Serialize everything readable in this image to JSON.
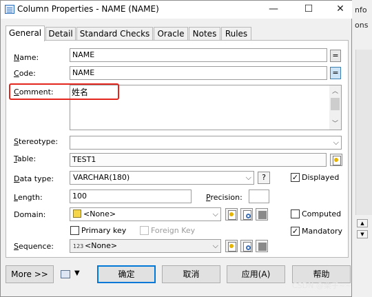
{
  "background_window": {
    "text1": "nfo",
    "text2": "ons"
  },
  "window": {
    "title": "Column Properties - NAME (NAME)",
    "minimize_glyph": "—",
    "maximize_glyph": "☐",
    "close_glyph": "✕"
  },
  "tabs": [
    {
      "label": "General"
    },
    {
      "label": "Detail"
    },
    {
      "label": "Standard Checks"
    },
    {
      "label": "Oracle"
    },
    {
      "label": "Notes"
    },
    {
      "label": "Rules"
    }
  ],
  "form": {
    "name_label_u": "N",
    "name_label_rest": "ame:",
    "name_value": "NAME",
    "code_label_u": "C",
    "code_label_rest": "ode:",
    "code_value": "NAME",
    "eq_glyph": "=",
    "comment_label_u": "C",
    "comment_label_rest": "omment:",
    "comment_value": "姓名",
    "stereotype_label_u": "S",
    "stereotype_label_rest": "tereotype:",
    "stereotype_value": "",
    "table_label_u": "T",
    "table_label_rest": "able:",
    "table_value": "TEST1",
    "datatype_label_u": "D",
    "datatype_label_rest": "ata type:",
    "datatype_value": "VARCHAR(180)",
    "datatype_help": "?",
    "displayed_label": "Displayed",
    "displayed_checked": true,
    "length_label_u": "L",
    "length_label_rest": "ength:",
    "length_value": "100",
    "precision_label_u": "P",
    "precision_label_rest": "recision:",
    "precision_value": "",
    "domain_label": "Domain:",
    "domain_value": "<None>",
    "computed_label": "Computed",
    "computed_checked": false,
    "primary_key_label": "Primary key",
    "primary_key_checked": false,
    "foreign_key_label": "Foreign Key",
    "foreign_key_checked": false,
    "mandatory_label": "Mandatory",
    "mandatory_checked": true,
    "sequence_label_u": "S",
    "sequence_label_rest": "equence:",
    "sequence_value": "<None>",
    "check_glyph": "✓",
    "dropdown_glyph": "⌵"
  },
  "buttons": {
    "more": "More >>",
    "ok": "确定",
    "cancel": "取消",
    "apply": "应用(A)",
    "help": "帮助"
  },
  "watermark": "CSDN @栗子~~"
}
